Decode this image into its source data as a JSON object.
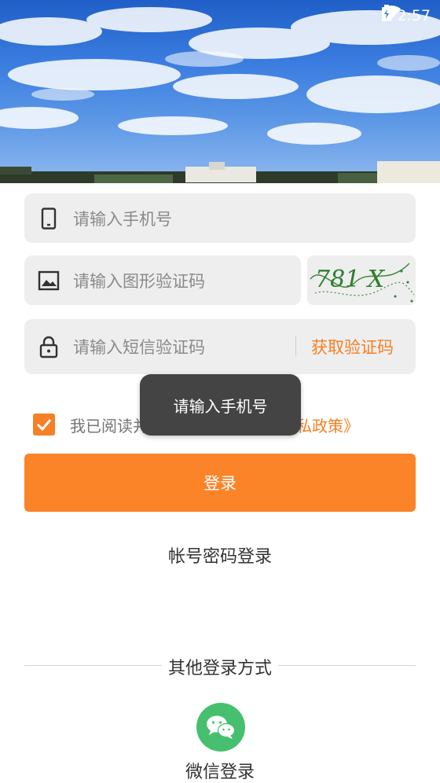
{
  "status_bar": {
    "time": "2:57",
    "wifi_icon": "wifi-icon",
    "battery_icon": "battery-charging-icon"
  },
  "form": {
    "phone_placeholder": "请输入手机号",
    "image_captcha_placeholder": "请输入图形验证码",
    "captcha_text": "781 X",
    "sms_code_placeholder": "请输入短信验证码",
    "get_code_label": "获取验证码"
  },
  "agreement": {
    "checked": true,
    "text": "我已阅读并同意",
    "link_text": "《用户协议及隐私政策》"
  },
  "toast": {
    "message": "请输入手机号"
  },
  "buttons": {
    "login": "登录",
    "password_login": "帐号密码登录"
  },
  "other_login": {
    "title": "其他登录方式",
    "wechat_label": "微信登录"
  },
  "colors": {
    "accent": "#fb8328",
    "link": "#f58025",
    "wechat": "#46c06f",
    "toast_bg": "#444444",
    "field_bg": "#eeeeee"
  }
}
